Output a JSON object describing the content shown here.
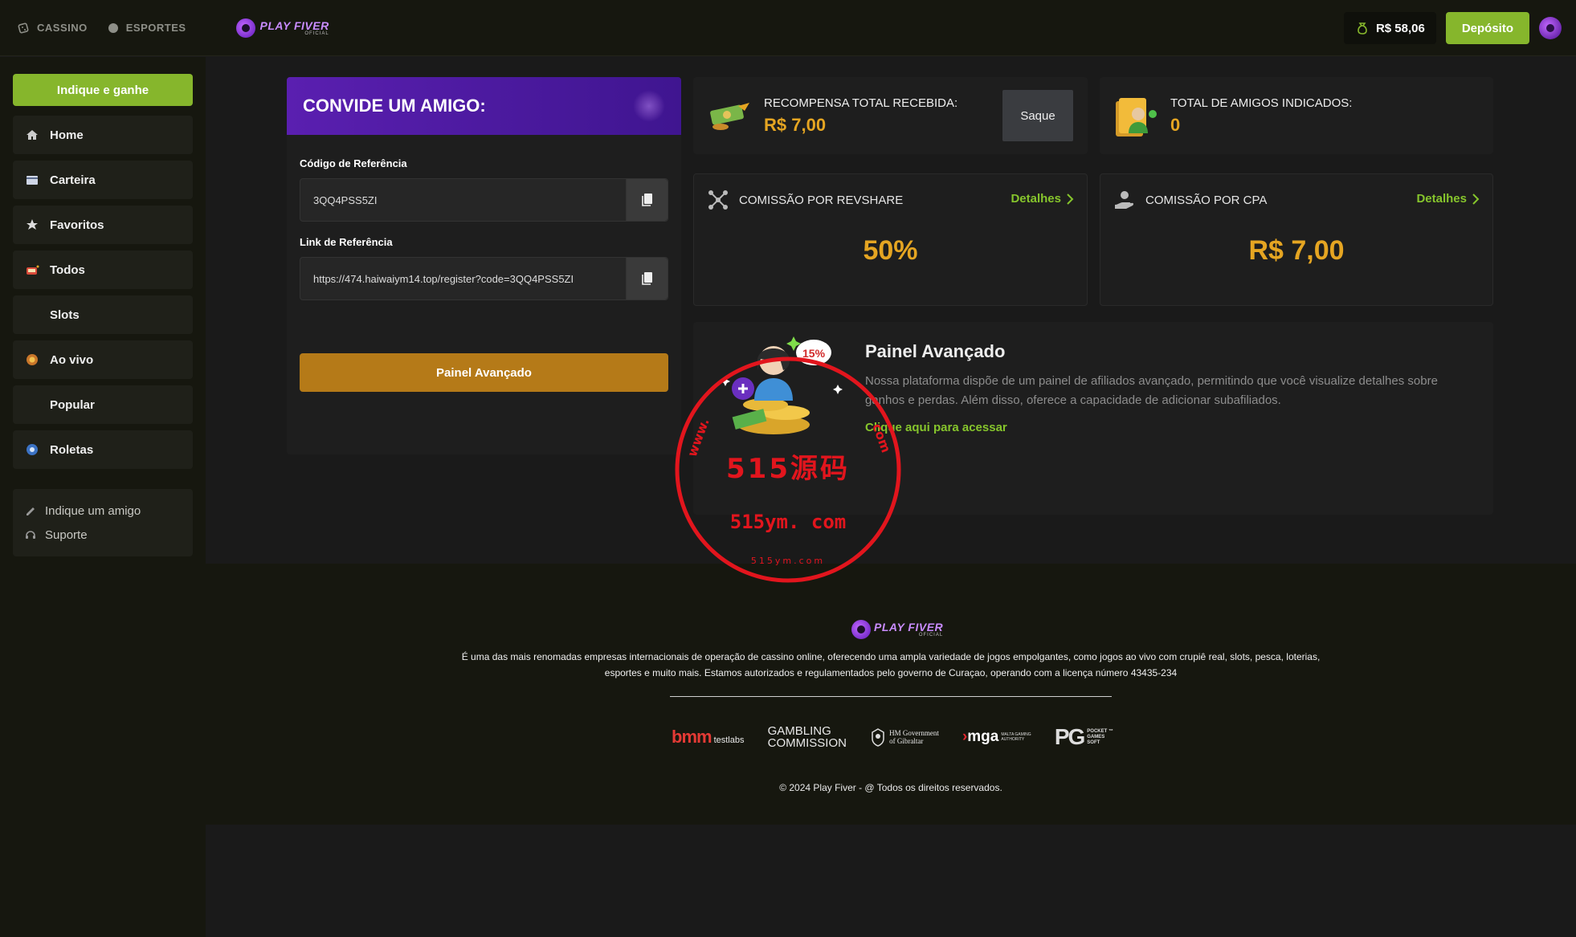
{
  "colors": {
    "accent_green": "#86b62c",
    "link_green": "#86c52c",
    "gold": "#e5a522",
    "orange_button": "#b57a18",
    "purple_header": "#5a1fb0",
    "stamp_red": "#e2151d"
  },
  "topbar": {
    "nav": [
      {
        "label": "CASSINO",
        "icon": "dice-icon"
      },
      {
        "label": "ESPORTES",
        "icon": "ball-icon"
      }
    ],
    "logo": {
      "title": "PLAY FIVER",
      "subtitle": "OFICIAL"
    },
    "balance": "R$ 58,06",
    "deposit_label": "Depósito"
  },
  "sidebar": {
    "invite_label": "Indique e ganhe",
    "items": [
      {
        "label": "Home",
        "icon": "home-icon"
      },
      {
        "label": "Carteira",
        "icon": "wallet-icon"
      },
      {
        "label": "Favoritos",
        "icon": "star-icon"
      },
      {
        "label": "Todos",
        "icon": "slot-machine-icon"
      },
      {
        "label": "Slots",
        "icon": ""
      },
      {
        "label": "Ao vivo",
        "icon": "live-chip-icon"
      },
      {
        "label": "Popular",
        "icon": ""
      },
      {
        "label": "Roletas",
        "icon": "roulette-icon"
      }
    ],
    "links": [
      {
        "label": "Indique um amigo",
        "icon": "referral-icon"
      },
      {
        "label": "Suporte",
        "icon": "headset-icon"
      }
    ]
  },
  "invite": {
    "title": "CONVIDE UM AMIGO:",
    "code_label": "Código de Referência",
    "code_value": "3QQ4PSS5ZI",
    "link_label": "Link de Referência",
    "link_value": "https://474.haiwaiym14.top/register?code=3QQ4PSS5ZI",
    "advanced_button": "Painel Avançado"
  },
  "stats": {
    "reward_label": "RECOMPENSA TOTAL RECEBIDA:",
    "reward_value": "R$ 7,00",
    "withdraw_label": "Saque",
    "friends_label": "TOTAL DE AMIGOS INDICADOS:",
    "friends_value": "0"
  },
  "commissions": {
    "revshare": {
      "label": "COMISSÃO POR REVSHARE",
      "details": "Detalhes",
      "value": "50%"
    },
    "cpa": {
      "label": "COMISSÃO POR CPA",
      "details": "Detalhes",
      "value": "R$ 7,00"
    }
  },
  "advanced": {
    "title": "Painel Avançado",
    "description": "Nossa plataforma dispõe de um painel de afiliados avançado, permitindo que você visualize detalhes sobre ganhos e perdas. Além disso, oferece a capacidade de adicionar subafiliados.",
    "link": "Clique aqui para acessar",
    "badge": "15%"
  },
  "footer": {
    "logo": {
      "title": "PLAY FIVER",
      "subtitle": "OFICIAL"
    },
    "description": "É uma das mais renomadas empresas internacionais de operação de cassino online, oferecendo uma ampla variedade de jogos empolgantes, como jogos ao vivo com crupiê real, slots, pesca, loterias, esportes e muito mais. Estamos autorizados e regulamentados pelo governo de Curaçao, operando com a licença número 43435-234",
    "partners": {
      "bmm": {
        "brand": "bmm",
        "sub": "testlabs"
      },
      "gambling_commission": "GAMBLING\nCOMMISSION",
      "gibraltar": "HM Government\nof Gibraltar",
      "mga": {
        "brand_prefix": "›",
        "brand": "mga",
        "sub": "MALTA GAMING\nAUTHORITY"
      },
      "pg": {
        "brand": "PG",
        "sub": "POCKET ™\nGAMES\nSOFT"
      }
    },
    "copyright": "© 2024 Play Fiver - @ Todos os direitos reservados."
  },
  "watermark": {
    "main": "515源码",
    "url": "515ym. com",
    "ring_left": "www.",
    "ring_right": "com",
    "bottom": "515ym.com"
  }
}
